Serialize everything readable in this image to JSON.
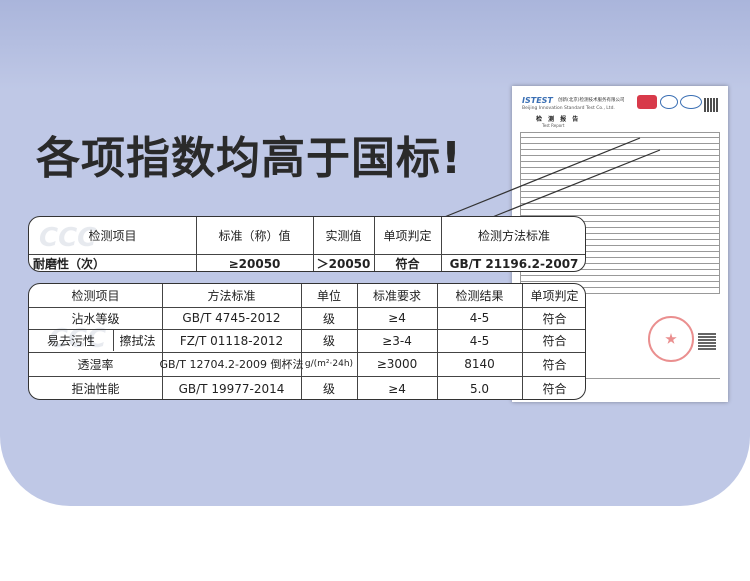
{
  "headline": "各项指数均高于国标!",
  "report": {
    "logo": "ISTEST",
    "org_cn": "创新(北京)检测技术服务有限公司",
    "org_en": "Beijing Innovation Standard Test Co., Ltd.",
    "title": "检 测 报 告",
    "subtitle": "Test Report"
  },
  "top_table": {
    "headers": [
      "检测项目",
      "标准（称）值",
      "实测值",
      "单项判定",
      "检测方法标准"
    ],
    "row": [
      "耐磨性（次）",
      "≥20050",
      "＞20050",
      "符合",
      "GB/T 21196.2-2007"
    ]
  },
  "main_table": {
    "headers": [
      "检测项目",
      "方法标准",
      "单位",
      "标准要求",
      "检测结果",
      "单项判定"
    ],
    "rows": [
      {
        "item": "沾水等级",
        "sub": "",
        "method": "GB/T 4745-2012",
        "unit": "级",
        "req": "≥4",
        "result": "4-5",
        "verdict": "符合"
      },
      {
        "item": "易去污性",
        "sub": "擦拭法",
        "method": "FZ/T 01118-2012",
        "unit": "级",
        "req": "≥3-4",
        "result": "4-5",
        "verdict": "符合"
      },
      {
        "item": "透湿率",
        "sub": "",
        "method": "GB/T 12704.2-2009 倒杯法",
        "unit": "g/(m²·24h)",
        "req": "≥3000",
        "result": "8140",
        "verdict": "符合"
      },
      {
        "item": "拒油性能",
        "sub": "",
        "method": "GB/T 19977-2014",
        "unit": "级",
        "req": "≥4",
        "result": "5.0",
        "verdict": "符合"
      }
    ]
  }
}
